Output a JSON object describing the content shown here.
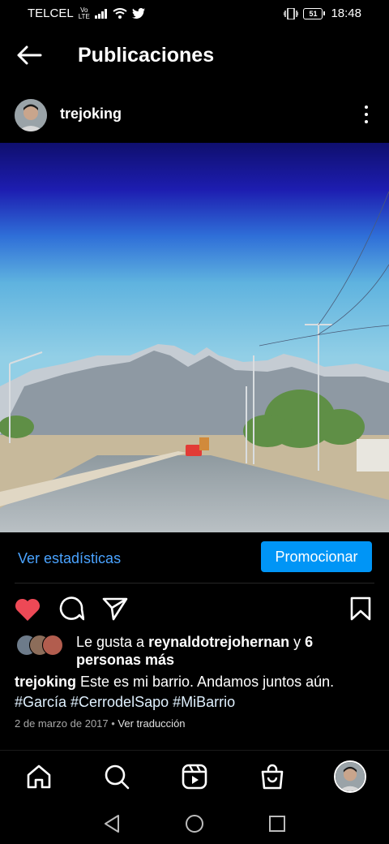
{
  "status_bar": {
    "carrier": "TELCEL",
    "network_badge_top": "Vo",
    "network_badge_bottom": "LTE",
    "battery": "51",
    "time": "18:48"
  },
  "header": {
    "title": "Publicaciones"
  },
  "post": {
    "username": "trejoking",
    "stats_link": "Ver estadísticas",
    "promote_label": "Promocionar",
    "likes_prefix": "Le gusta a ",
    "likes_user": "reynaldotrejohernan",
    "likes_middle": " y ",
    "likes_count_text": "6 personas más",
    "caption_user": "trejoking",
    "caption_text": " Este es mi barrio. Andamos juntos aún.",
    "hashtags": "#García #CerrodelSapo #MiBarrio",
    "date": "2 de marzo de 2017",
    "separator": " • ",
    "translate_label": "Ver traducción"
  },
  "colors": {
    "accent": "#0095f6",
    "link": "#4aa3ff",
    "like": "#ed4956"
  },
  "icons": [
    "back-arrow-icon",
    "more-icon",
    "heart-icon",
    "comment-icon",
    "share-icon",
    "bookmark-icon",
    "home-icon",
    "search-icon",
    "reels-icon",
    "shop-icon",
    "profile-avatar"
  ]
}
